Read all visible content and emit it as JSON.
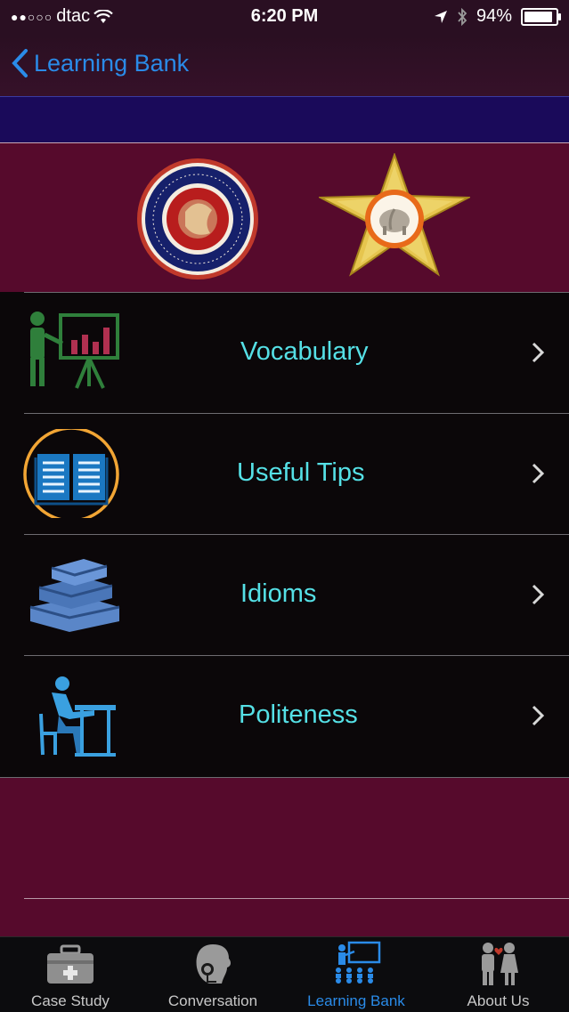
{
  "status": {
    "carrier": "dtac",
    "time": "6:20 PM",
    "battery": "94%"
  },
  "nav": {
    "back_label": "Learning Bank"
  },
  "logos": {
    "left": "SIAM UNIVERSITY seal",
    "right": "star emblem"
  },
  "menu": [
    {
      "label": "Vocabulary",
      "icon": "presentation-icon"
    },
    {
      "label": "Useful Tips",
      "icon": "open-book-icon"
    },
    {
      "label": "Idioms",
      "icon": "books-stack-icon"
    },
    {
      "label": "Politeness",
      "icon": "student-desk-icon"
    }
  ],
  "tabs": [
    {
      "label": "Case Study",
      "icon": "medical-kit-icon"
    },
    {
      "label": "Conversation",
      "icon": "headset-person-icon"
    },
    {
      "label": "Learning Bank",
      "icon": "classroom-icon",
      "active": true
    },
    {
      "label": "About Us",
      "icon": "couple-icon"
    }
  ],
  "colors": {
    "accent": "#2a8be8",
    "menu_text": "#55e0e6",
    "background": "#560a2c"
  }
}
